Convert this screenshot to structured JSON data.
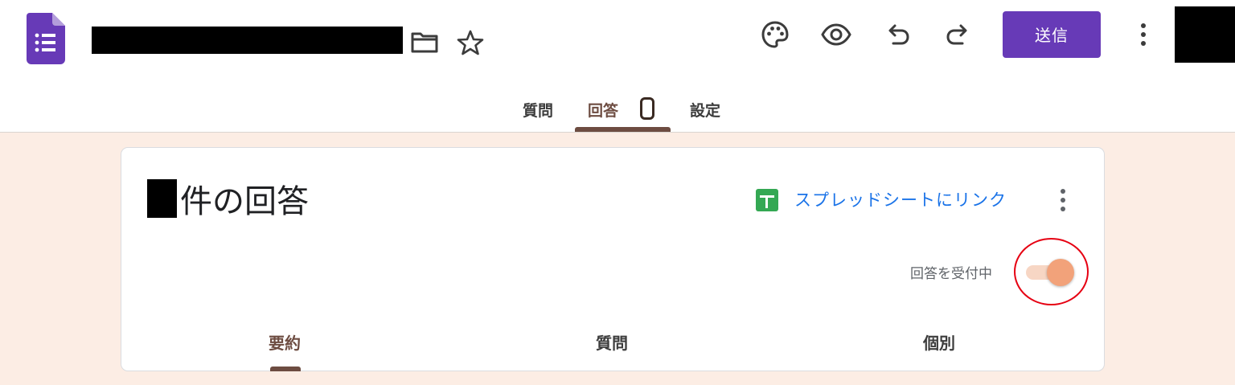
{
  "header": {
    "send_label": "送信"
  },
  "tabs": {
    "questions": "質問",
    "responses": "回答",
    "settings": "設定"
  },
  "card": {
    "responses_title": "件の回答",
    "link_sheets": "スプレッドシートにリンク",
    "accepting_label": "回答を受付中",
    "accepting_enabled": true
  },
  "subtabs": {
    "summary": "要約",
    "question": "質問",
    "individual": "個別"
  },
  "icons": {
    "logo": "google-forms-icon",
    "folder": "folder-icon",
    "star": "star-icon",
    "palette": "palette-icon",
    "preview": "eye-icon",
    "undo": "undo-icon",
    "redo": "redo-icon",
    "more": "more-vert-icon",
    "sheets": "google-sheets-icon"
  },
  "colors": {
    "brand": "#673ab7",
    "accent": "#6d4c41",
    "background": "#fcede4",
    "link": "#1a73e8",
    "toggle_thumb": "#f2a27a",
    "toggle_track": "#f7d6c4",
    "highlight": "#e60012"
  }
}
